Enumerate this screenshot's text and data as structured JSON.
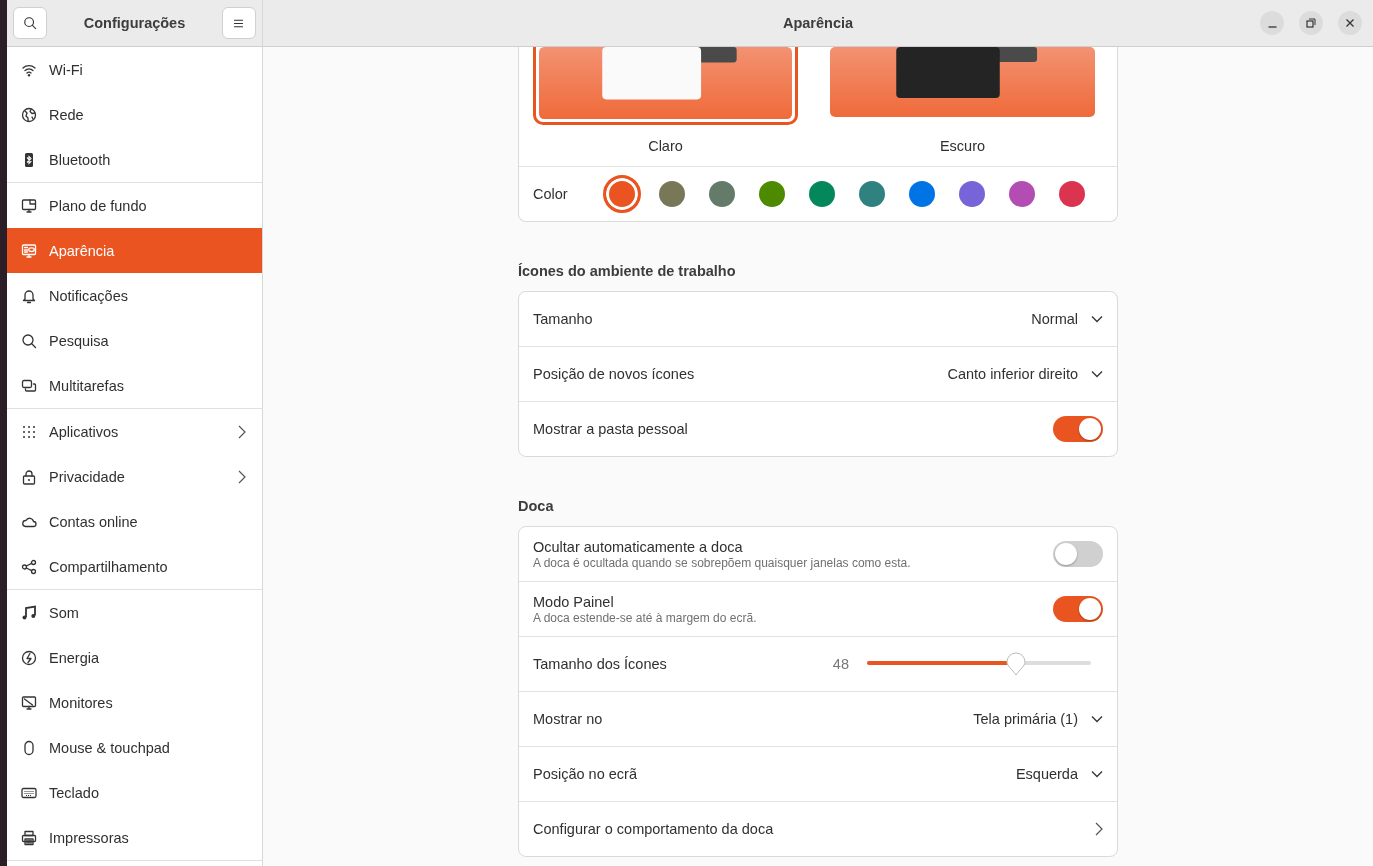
{
  "window": {
    "title": "Aparência"
  },
  "sidebar": {
    "title": "Configurações",
    "groups": [
      [
        {
          "label": "Wi-Fi",
          "selected": false,
          "submenu": false
        },
        {
          "label": "Rede",
          "selected": false,
          "submenu": false
        },
        {
          "label": "Bluetooth",
          "selected": false,
          "submenu": false
        }
      ],
      [
        {
          "label": "Plano de fundo",
          "selected": false,
          "submenu": false
        },
        {
          "label": "Aparência",
          "selected": true,
          "submenu": false
        },
        {
          "label": "Notificações",
          "selected": false,
          "submenu": false
        },
        {
          "label": "Pesquisa",
          "selected": false,
          "submenu": false
        },
        {
          "label": "Multitarefas",
          "selected": false,
          "submenu": false
        }
      ],
      [
        {
          "label": "Aplicativos",
          "selected": false,
          "submenu": true
        },
        {
          "label": "Privacidade",
          "selected": false,
          "submenu": true
        },
        {
          "label": "Contas online",
          "selected": false,
          "submenu": false
        },
        {
          "label": "Compartilhamento",
          "selected": false,
          "submenu": false
        }
      ],
      [
        {
          "label": "Som",
          "selected": false,
          "submenu": false
        },
        {
          "label": "Energia",
          "selected": false,
          "submenu": false
        },
        {
          "label": "Monitores",
          "selected": false,
          "submenu": false
        },
        {
          "label": "Mouse & touchpad",
          "selected": false,
          "submenu": false
        },
        {
          "label": "Teclado",
          "selected": false,
          "submenu": false
        },
        {
          "label": "Impressoras",
          "selected": false,
          "submenu": false
        }
      ]
    ]
  },
  "style": {
    "options": [
      {
        "kind": "light",
        "label": "Claro",
        "selected": true
      },
      {
        "kind": "dark",
        "label": "Escuro",
        "selected": false
      }
    ],
    "color_label": "Color",
    "colors": [
      {
        "color": "#e95420",
        "selected": true
      },
      {
        "color": "#787859",
        "selected": false
      },
      {
        "color": "#657b69",
        "selected": false
      },
      {
        "color": "#4e8a00",
        "selected": false
      },
      {
        "color": "#03875b",
        "selected": false
      },
      {
        "color": "#308280",
        "selected": false
      },
      {
        "color": "#0073e5",
        "selected": false
      },
      {
        "color": "#7764d8",
        "selected": false
      },
      {
        "color": "#b34cb3",
        "selected": false
      },
      {
        "color": "#da3450",
        "selected": false
      }
    ]
  },
  "sections": [
    {
      "heading": "Ícones do ambiente de trabalho",
      "rows": [
        {
          "kind": "dropdown",
          "label": "Tamanho",
          "value": "Normal"
        },
        {
          "kind": "dropdown",
          "label": "Posição de novos ícones",
          "value": "Canto inferior direito"
        },
        {
          "kind": "switch",
          "label": "Mostrar a pasta pessoal",
          "on": true
        }
      ]
    },
    {
      "heading": "Doca",
      "rows": [
        {
          "kind": "switch",
          "label": "Ocultar automaticamente a doca",
          "subtitle": "A doca é ocultada quando se sobrepõem quaisquer janelas como esta.",
          "on": false
        },
        {
          "kind": "switch",
          "label": "Modo Painel",
          "subtitle": "A doca estende-se até à margem do ecrã.",
          "on": true
        },
        {
          "kind": "slider",
          "label": "Tamanho dos Ícones",
          "reading": "48",
          "level": 0.665
        },
        {
          "kind": "dropdown",
          "label": "Mostrar no",
          "value": "Tela primária (1)"
        },
        {
          "kind": "dropdown",
          "label": "Posição no ecrã",
          "value": "Esquerda"
        },
        {
          "kind": "link",
          "label": "Configurar o comportamento da doca"
        }
      ]
    }
  ]
}
